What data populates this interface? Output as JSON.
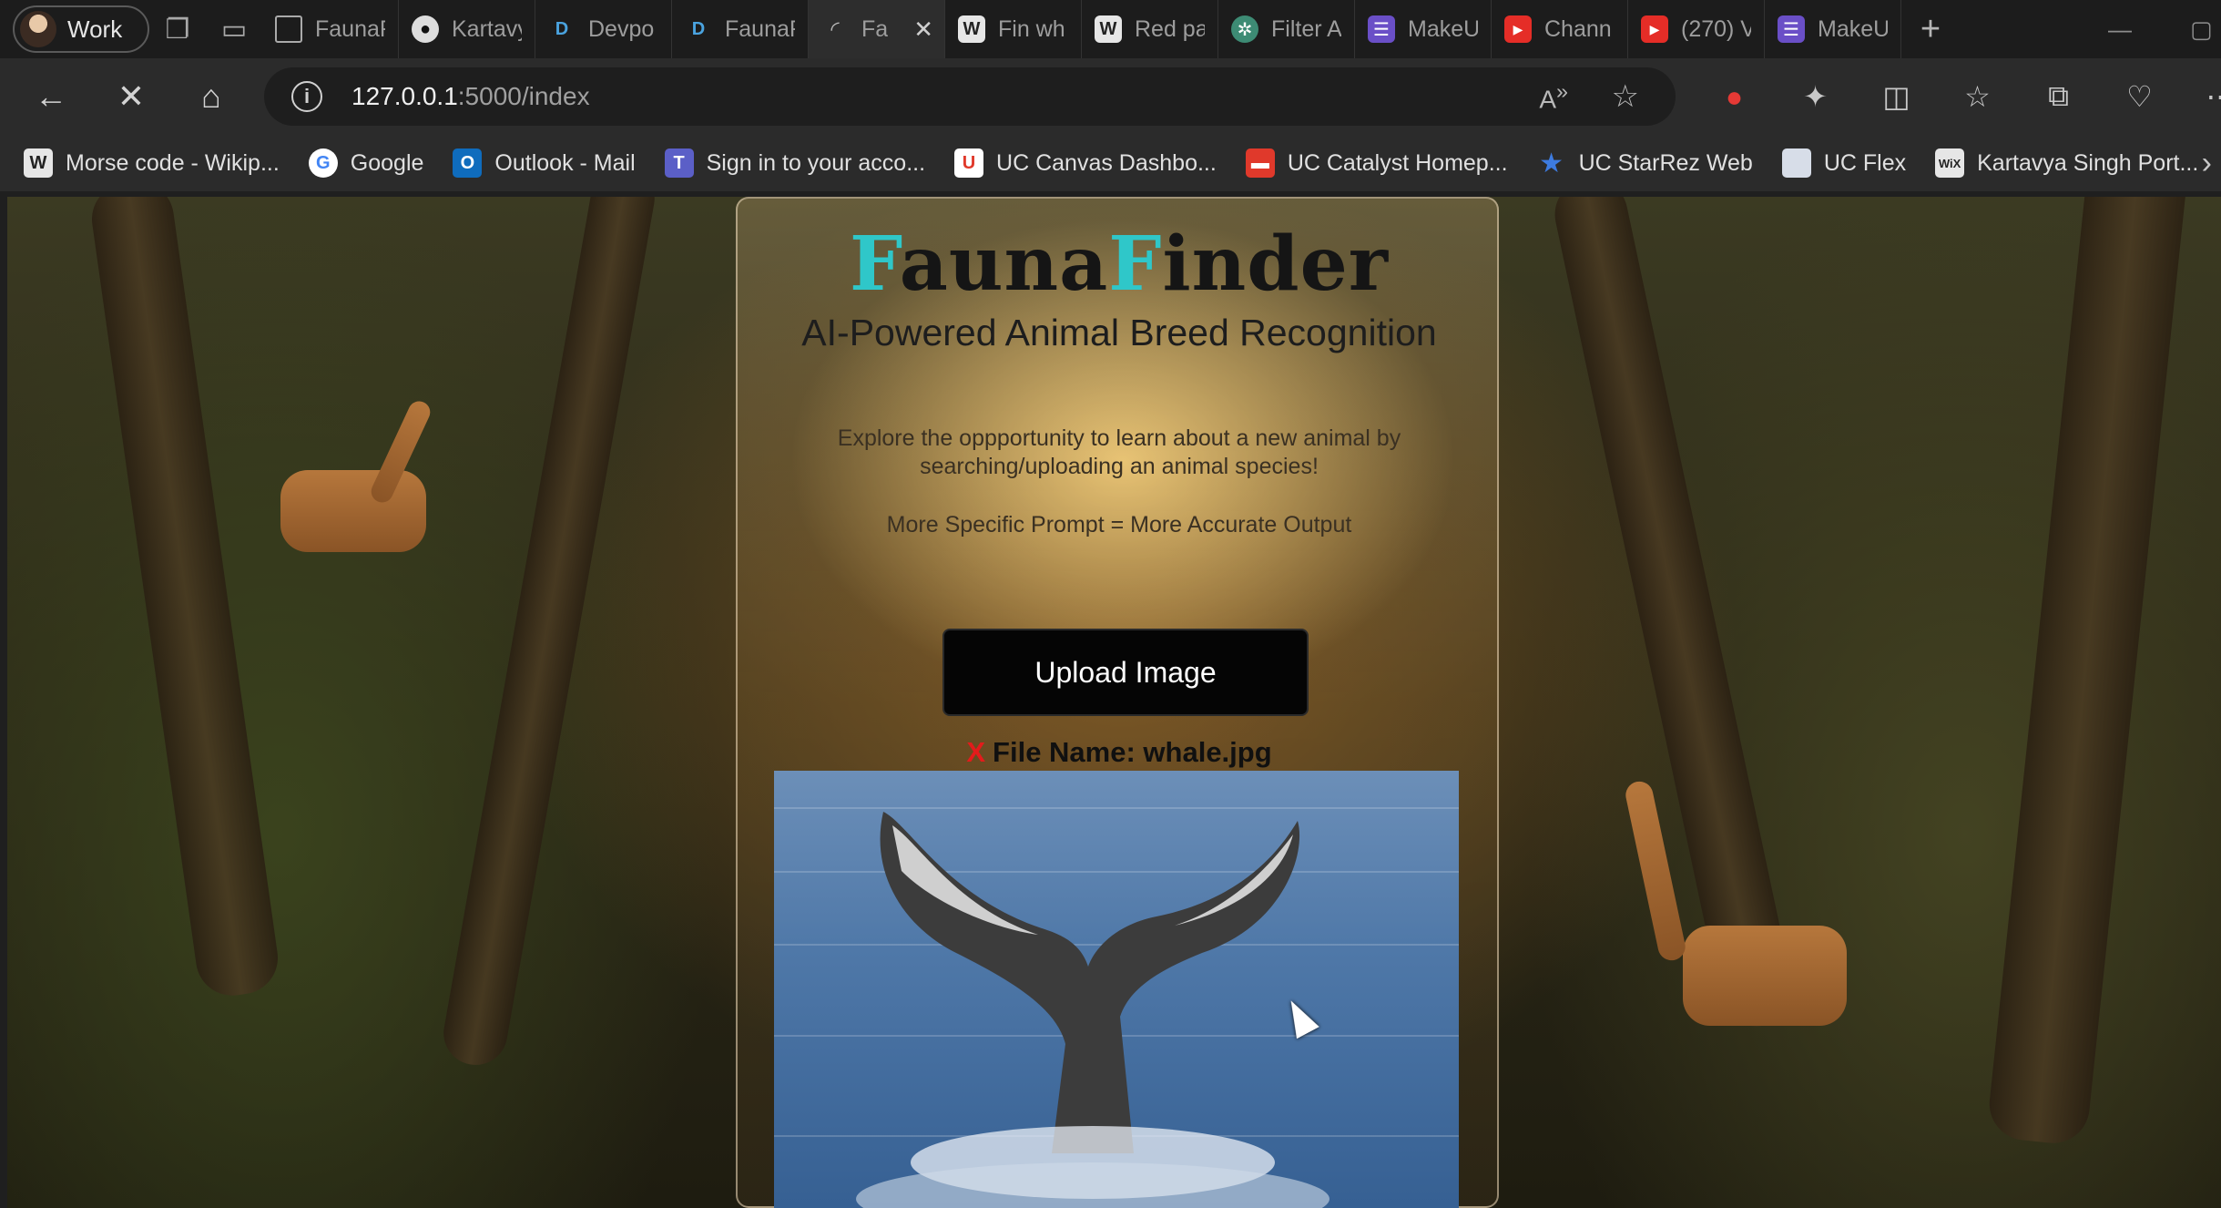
{
  "browser": {
    "profile_label": "Work",
    "tabs": [
      {
        "label": "FaunaF",
        "icon": "page-icon"
      },
      {
        "label": "Kartavy",
        "icon": "github-icon"
      },
      {
        "label": "Devpo",
        "icon": "d-icon"
      },
      {
        "label": "FaunaF",
        "icon": "d-icon"
      },
      {
        "label": "Fa",
        "icon": "loading-icon",
        "active": true
      },
      {
        "label": "Fin wh",
        "icon": "wikipedia-icon"
      },
      {
        "label": "Red pa",
        "icon": "wikipedia-icon"
      },
      {
        "label": "Filter A",
        "icon": "chatgpt-icon"
      },
      {
        "label": "MakeU",
        "icon": "list-icon"
      },
      {
        "label": "Chann",
        "icon": "youtube-icon"
      },
      {
        "label": "(270) V",
        "icon": "youtube-icon"
      },
      {
        "label": "MakeU",
        "icon": "list-icon"
      }
    ],
    "url_host": "127.0.0.1",
    "url_path": ":5000/index",
    "bookmarks": [
      {
        "label": "Morse code - Wikip...",
        "icon": "wikipedia-icon"
      },
      {
        "label": "Google",
        "icon": "google-icon"
      },
      {
        "label": "Outlook - Mail",
        "icon": "outlook-icon"
      },
      {
        "label": "Sign in to your acco...",
        "icon": "teams-icon"
      },
      {
        "label": "UC Canvas Dashbo...",
        "icon": "canvas-icon"
      },
      {
        "label": "UC Catalyst Homep...",
        "icon": "catalyst-icon"
      },
      {
        "label": "UC StarRez Web",
        "icon": "star-icon"
      },
      {
        "label": "UC Flex",
        "icon": "page-icon"
      },
      {
        "label": "Kartavya Singh Port...",
        "icon": "wix-icon"
      }
    ]
  },
  "app": {
    "title_part1_accent": "F",
    "title_part1_rest": "auna",
    "title_part2_accent": "F",
    "title_part2_rest": "inder",
    "subtitle": "AI-Powered Animal Breed Recognition",
    "description": "Explore the oppportunity to learn about a new animal by searching/uploading an animal species!",
    "tip": "More Specific Prompt = More Accurate Output",
    "upload_button": "Upload Image",
    "remove_mark": "X",
    "file_label": "File Name: whale.jpg"
  },
  "colors": {
    "accent": "#2fc7c9",
    "remove_red": "#e31b1b"
  }
}
